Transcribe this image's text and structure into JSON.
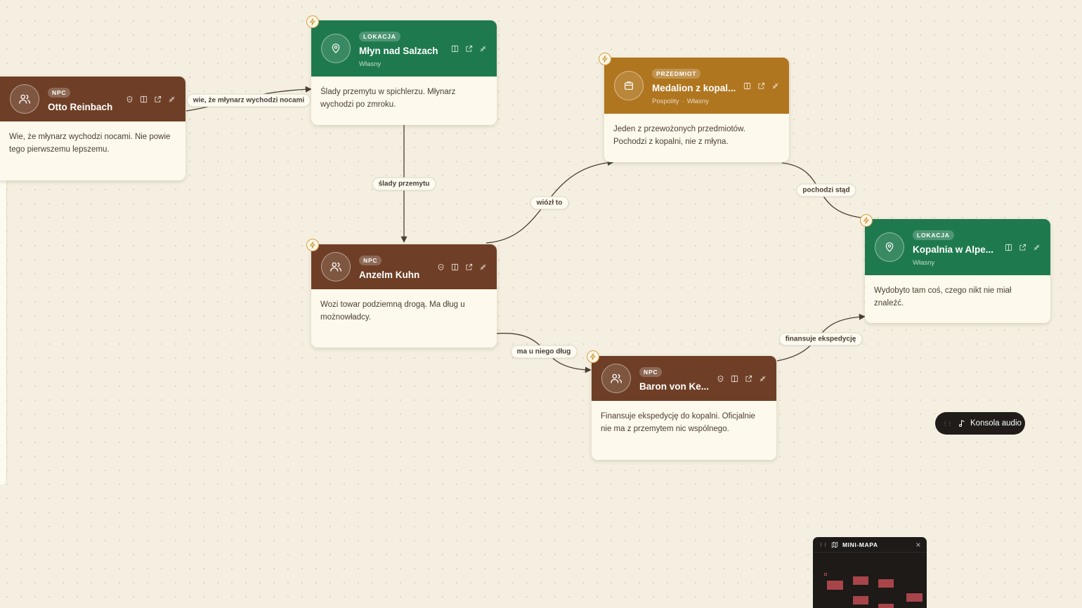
{
  "nodes": {
    "otto": {
      "badge": "NPC",
      "title": "Otto Reinbach",
      "body": "Wie, że młynarz wychodzi nocami. Nie powie tego pierwszemu lepszemu."
    },
    "mlyn": {
      "badge": "LOKACJA",
      "title": "Młyn nad Salzach",
      "meta": [
        "Własny"
      ],
      "body": "Ślady przemytu w spichlerzu. Młynarz wychodzi po zmroku."
    },
    "medalion": {
      "badge": "PRZEDMIOT",
      "title": "Medalion z kopal...",
      "meta": [
        "Pospolity",
        "Własny"
      ],
      "body": "Jeden z przewożonych przedmiotów. Pochodzi z kopalni, nie z młyna."
    },
    "anzelm": {
      "badge": "NPC",
      "title": "Anzelm Kuhn",
      "body": "Wozi towar podziemną drogą. Ma dług u możnowładcy."
    },
    "kopalnia": {
      "badge": "LOKACJA",
      "title": "Kopalnia w Alpe...",
      "meta": [
        "Własny"
      ],
      "body": "Wydobyto tam coś, czego nikt nie miał znaleźć."
    },
    "baron": {
      "badge": "NPC",
      "title": "Baron von Ke...",
      "body": "Finansuje ekspedycję do kopalni. Oficjalnie nie ma z przemytem nic wspólnego."
    }
  },
  "edges": {
    "otto_mlyn": "wie, że młynarz wychodzi nocami",
    "mlyn_anzelm": "ślady przemytu",
    "anzelm_medalion": "wiózł to",
    "medalion_kopalnia": "pochodzi stąd",
    "anzelm_baron": "ma u niego dług",
    "baron_kopalnia": "finansuje ekspedycję"
  },
  "audio": {
    "label": "Konsola audio"
  },
  "minimap": {
    "title": "MINI-MAPA",
    "close": "×"
  },
  "colors": {
    "npc": "#6e3f26",
    "location": "#1e7a4e",
    "item": "#b0761f",
    "background": "#f4efe1"
  }
}
